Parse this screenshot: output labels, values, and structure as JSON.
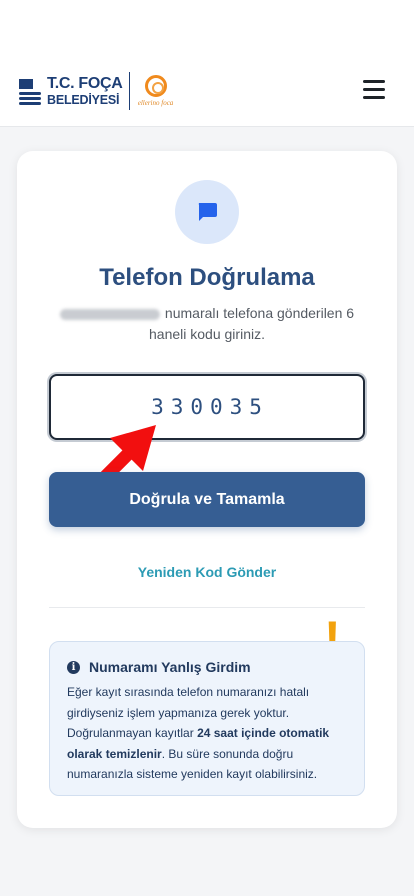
{
  "header": {
    "logo_line1": "T.C. FOÇA",
    "logo_line2": "BELEDİYESİ",
    "logo_sub": "ellerino foca",
    "menu_icon": "hamburger-menu-icon"
  },
  "verify": {
    "icon": "chat-bubble-icon",
    "title": "Telefon Doğrulama",
    "desc": "numaralı telefona gönderilen 6 haneli kodu giriniz.",
    "code_value": "330035",
    "submit_label": "Doğrula ve Tamamla",
    "resend_label": "Yeniden Kod Gönder"
  },
  "info": {
    "icon": "info-circle-icon",
    "heading": "Numaramı Yanlış Girdim",
    "text1": "Eğer kayıt sırasında telefon numaranızı hatalı girdiyseniz işlem yapmanıza gerek yoktur. Doğrulanmayan kayıtlar ",
    "text_bold": "24 saat içinde otomatik olarak temizlenir",
    "text2": ". Bu süre sonunda doğru numaranızla sisteme yeniden kayıt olabilirsiniz.",
    "exclamation": "!"
  },
  "colors": {
    "brand": "#2d4f7f",
    "button": "#365e93",
    "link": "#2c9bb4",
    "warning": "#f2a20d",
    "arrow": "#f20f0f"
  }
}
